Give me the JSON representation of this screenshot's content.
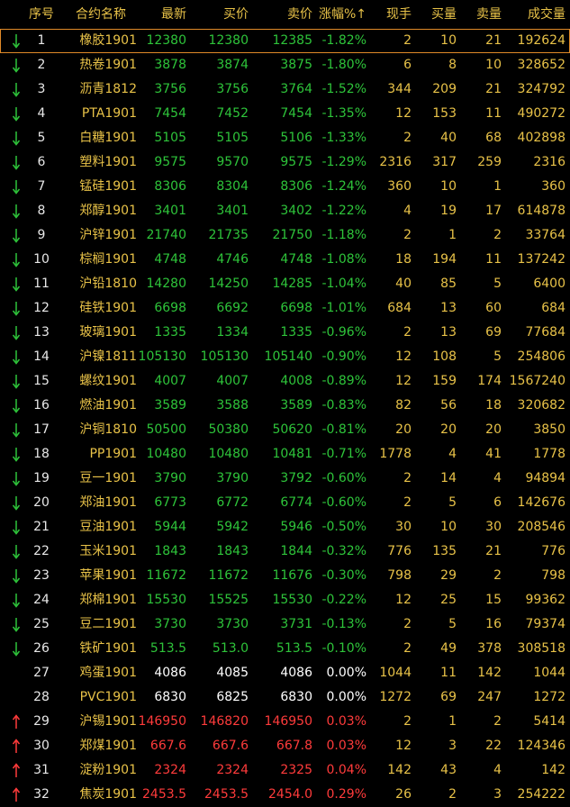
{
  "colors": {
    "up": "#ff3b3b",
    "down": "#2ec43a",
    "flat": "#ffffff",
    "label": "#e8c248",
    "highlight": "#e08a28"
  },
  "headers": {
    "seq": "序号",
    "name": "合约名称",
    "last": "最新",
    "bid": "买价",
    "ask": "卖价",
    "change": "涨幅%↑",
    "vol": "现手",
    "bid_vol": "买量",
    "ask_vol": "卖量",
    "volume": "成交量"
  },
  "rows": [
    {
      "seq": "1",
      "name": "橡胶1901",
      "last": "12380",
      "bid": "12380",
      "ask": "12385",
      "change": "-1.82%",
      "vol": "2",
      "bid_vol": "10",
      "ask_vol": "21",
      "volume": "192624",
      "dir": "down",
      "arrow": "down-arrow-icon"
    },
    {
      "seq": "2",
      "name": "热卷1901",
      "last": "3878",
      "bid": "3874",
      "ask": "3875",
      "change": "-1.80%",
      "vol": "6",
      "bid_vol": "8",
      "ask_vol": "10",
      "volume": "328652",
      "dir": "down",
      "arrow": "down-arrow-icon"
    },
    {
      "seq": "3",
      "name": "沥青1812",
      "last": "3756",
      "bid": "3756",
      "ask": "3764",
      "change": "-1.52%",
      "vol": "344",
      "bid_vol": "209",
      "ask_vol": "21",
      "volume": "324792",
      "dir": "down",
      "arrow": "down-arrow-icon"
    },
    {
      "seq": "4",
      "name": "PTA1901",
      "last": "7454",
      "bid": "7452",
      "ask": "7454",
      "change": "-1.35%",
      "vol": "12",
      "bid_vol": "153",
      "ask_vol": "11",
      "volume": "490272",
      "dir": "down",
      "arrow": "down-arrow-icon"
    },
    {
      "seq": "5",
      "name": "白糖1901",
      "last": "5105",
      "bid": "5105",
      "ask": "5106",
      "change": "-1.33%",
      "vol": "2",
      "bid_vol": "40",
      "ask_vol": "68",
      "volume": "402898",
      "dir": "down",
      "arrow": "down-arrow-icon"
    },
    {
      "seq": "6",
      "name": "塑料1901",
      "last": "9575",
      "bid": "9570",
      "ask": "9575",
      "change": "-1.29%",
      "vol": "2316",
      "bid_vol": "317",
      "ask_vol": "259",
      "volume": "2316",
      "dir": "down",
      "arrow": "down-arrow-icon"
    },
    {
      "seq": "7",
      "name": "锰硅1901",
      "last": "8306",
      "bid": "8304",
      "ask": "8306",
      "change": "-1.24%",
      "vol": "360",
      "bid_vol": "10",
      "ask_vol": "1",
      "volume": "360",
      "dir": "down",
      "arrow": "down-arrow-icon"
    },
    {
      "seq": "8",
      "name": "郑醇1901",
      "last": "3401",
      "bid": "3401",
      "ask": "3402",
      "change": "-1.22%",
      "vol": "4",
      "bid_vol": "19",
      "ask_vol": "17",
      "volume": "614878",
      "dir": "down",
      "arrow": "down-arrow-icon"
    },
    {
      "seq": "9",
      "name": "沪锌1901",
      "last": "21740",
      "bid": "21735",
      "ask": "21750",
      "change": "-1.18%",
      "vol": "2",
      "bid_vol": "1",
      "ask_vol": "2",
      "volume": "33764",
      "dir": "down",
      "arrow": "down-arrow-icon"
    },
    {
      "seq": "10",
      "name": "棕榈1901",
      "last": "4748",
      "bid": "4746",
      "ask": "4748",
      "change": "-1.08%",
      "vol": "18",
      "bid_vol": "194",
      "ask_vol": "11",
      "volume": "137242",
      "dir": "down",
      "arrow": "down-arrow-icon"
    },
    {
      "seq": "11",
      "name": "沪铅1810",
      "last": "14280",
      "bid": "14250",
      "ask": "14285",
      "change": "-1.04%",
      "vol": "40",
      "bid_vol": "85",
      "ask_vol": "5",
      "volume": "6400",
      "dir": "down",
      "arrow": "down-arrow-icon"
    },
    {
      "seq": "12",
      "name": "硅铁1901",
      "last": "6698",
      "bid": "6692",
      "ask": "6698",
      "change": "-1.01%",
      "vol": "684",
      "bid_vol": "13",
      "ask_vol": "60",
      "volume": "684",
      "dir": "down",
      "arrow": "down-arrow-icon"
    },
    {
      "seq": "13",
      "name": "玻璃1901",
      "last": "1335",
      "bid": "1334",
      "ask": "1335",
      "change": "-0.96%",
      "vol": "2",
      "bid_vol": "13",
      "ask_vol": "69",
      "volume": "77684",
      "dir": "down",
      "arrow": "down-arrow-icon"
    },
    {
      "seq": "14",
      "name": "沪镍1811",
      "last": "105130",
      "bid": "105130",
      "ask": "105140",
      "change": "-0.90%",
      "vol": "12",
      "bid_vol": "108",
      "ask_vol": "5",
      "volume": "254806",
      "dir": "down",
      "arrow": "down-arrow-icon"
    },
    {
      "seq": "15",
      "name": "螺纹1901",
      "last": "4007",
      "bid": "4007",
      "ask": "4008",
      "change": "-0.89%",
      "vol": "12",
      "bid_vol": "159",
      "ask_vol": "174",
      "volume": "1567240",
      "dir": "down",
      "arrow": "down-arrow-icon"
    },
    {
      "seq": "16",
      "name": "燃油1901",
      "last": "3589",
      "bid": "3588",
      "ask": "3589",
      "change": "-0.83%",
      "vol": "82",
      "bid_vol": "56",
      "ask_vol": "18",
      "volume": "320682",
      "dir": "down",
      "arrow": "down-arrow-icon"
    },
    {
      "seq": "17",
      "name": "沪铜1810",
      "last": "50500",
      "bid": "50380",
      "ask": "50620",
      "change": "-0.81%",
      "vol": "20",
      "bid_vol": "20",
      "ask_vol": "20",
      "volume": "3850",
      "dir": "down",
      "arrow": "down-arrow-icon"
    },
    {
      "seq": "18",
      "name": "PP1901",
      "last": "10480",
      "bid": "10480",
      "ask": "10481",
      "change": "-0.71%",
      "vol": "1778",
      "bid_vol": "4",
      "ask_vol": "41",
      "volume": "1778",
      "dir": "down",
      "arrow": "down-arrow-icon"
    },
    {
      "seq": "19",
      "name": "豆一1901",
      "last": "3790",
      "bid": "3790",
      "ask": "3792",
      "change": "-0.60%",
      "vol": "2",
      "bid_vol": "14",
      "ask_vol": "4",
      "volume": "94894",
      "dir": "down",
      "arrow": "down-arrow-icon"
    },
    {
      "seq": "20",
      "name": "郑油1901",
      "last": "6773",
      "bid": "6772",
      "ask": "6774",
      "change": "-0.60%",
      "vol": "2",
      "bid_vol": "5",
      "ask_vol": "6",
      "volume": "142676",
      "dir": "down",
      "arrow": "down-arrow-icon"
    },
    {
      "seq": "21",
      "name": "豆油1901",
      "last": "5944",
      "bid": "5942",
      "ask": "5946",
      "change": "-0.50%",
      "vol": "30",
      "bid_vol": "10",
      "ask_vol": "30",
      "volume": "208546",
      "dir": "down",
      "arrow": "down-arrow-icon"
    },
    {
      "seq": "22",
      "name": "玉米1901",
      "last": "1843",
      "bid": "1843",
      "ask": "1844",
      "change": "-0.32%",
      "vol": "776",
      "bid_vol": "135",
      "ask_vol": "21",
      "volume": "776",
      "dir": "down",
      "arrow": "down-arrow-icon"
    },
    {
      "seq": "23",
      "name": "苹果1901",
      "last": "11672",
      "bid": "11672",
      "ask": "11676",
      "change": "-0.30%",
      "vol": "798",
      "bid_vol": "29",
      "ask_vol": "2",
      "volume": "798",
      "dir": "down",
      "arrow": "down-arrow-icon"
    },
    {
      "seq": "24",
      "name": "郑棉1901",
      "last": "15530",
      "bid": "15525",
      "ask": "15530",
      "change": "-0.22%",
      "vol": "12",
      "bid_vol": "25",
      "ask_vol": "15",
      "volume": "99362",
      "dir": "down",
      "arrow": "down-arrow-icon"
    },
    {
      "seq": "25",
      "name": "豆二1901",
      "last": "3730",
      "bid": "3730",
      "ask": "3731",
      "change": "-0.13%",
      "vol": "2",
      "bid_vol": "5",
      "ask_vol": "16",
      "volume": "79374",
      "dir": "down",
      "arrow": "down-arrow-icon"
    },
    {
      "seq": "26",
      "name": "铁矿1901",
      "last": "513.5",
      "bid": "513.0",
      "ask": "513.5",
      "change": "-0.10%",
      "vol": "2",
      "bid_vol": "49",
      "ask_vol": "378",
      "volume": "308518",
      "dir": "down",
      "arrow": "down-arrow-icon"
    },
    {
      "seq": "27",
      "name": "鸡蛋1901",
      "last": "4086",
      "bid": "4085",
      "ask": "4086",
      "change": "0.00%",
      "vol": "1044",
      "bid_vol": "11",
      "ask_vol": "142",
      "volume": "1044",
      "dir": "flat",
      "arrow": ""
    },
    {
      "seq": "28",
      "name": "PVC1901",
      "last": "6830",
      "bid": "6825",
      "ask": "6830",
      "change": "0.00%",
      "vol": "1272",
      "bid_vol": "69",
      "ask_vol": "247",
      "volume": "1272",
      "dir": "flat",
      "arrow": ""
    },
    {
      "seq": "29",
      "name": "沪锡1901",
      "last": "146950",
      "bid": "146820",
      "ask": "146950",
      "change": "0.03%",
      "vol": "2",
      "bid_vol": "1",
      "ask_vol": "2",
      "volume": "5414",
      "dir": "up",
      "arrow": "up-arrow-icon"
    },
    {
      "seq": "30",
      "name": "郑煤1901",
      "last": "667.6",
      "bid": "667.6",
      "ask": "667.8",
      "change": "0.03%",
      "vol": "12",
      "bid_vol": "3",
      "ask_vol": "22",
      "volume": "124346",
      "dir": "up",
      "arrow": "up-arrow-icon"
    },
    {
      "seq": "31",
      "name": "淀粉1901",
      "last": "2324",
      "bid": "2324",
      "ask": "2325",
      "change": "0.04%",
      "vol": "142",
      "bid_vol": "43",
      "ask_vol": "4",
      "volume": "142",
      "dir": "up",
      "arrow": "up-arrow-icon"
    },
    {
      "seq": "32",
      "name": "焦炭1901",
      "last": "2453.5",
      "bid": "2453.5",
      "ask": "2454.0",
      "change": "0.29%",
      "vol": "26",
      "bid_vol": "2",
      "ask_vol": "3",
      "volume": "254222",
      "dir": "up",
      "arrow": "up-arrow-icon"
    }
  ]
}
